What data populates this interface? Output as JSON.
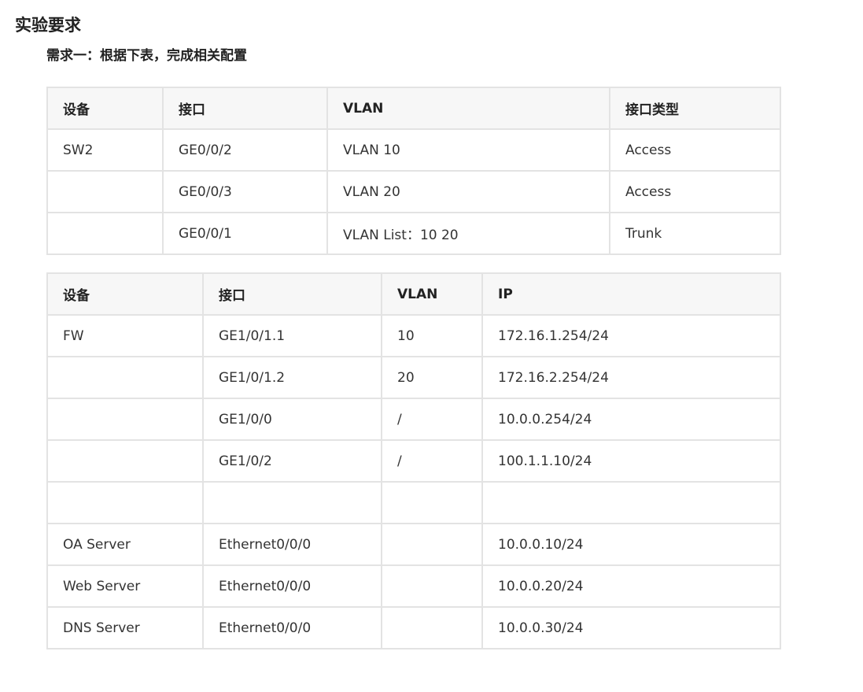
{
  "page": {
    "title": "实验要求",
    "subtitle": "需求一：根据下表，完成相关配置"
  },
  "table1": {
    "headers": [
      "设备",
      "接口",
      "VLAN",
      "接口类型"
    ],
    "rows": [
      [
        "SW2",
        "GE0/0/2",
        "VLAN 10",
        "Access"
      ],
      [
        "",
        "GE0/0/3",
        "VLAN 20",
        "Access"
      ],
      [
        "",
        "GE0/0/1",
        "VLAN List：10 20",
        "Trunk"
      ]
    ]
  },
  "table2": {
    "headers": [
      "设备",
      "接口",
      "VLAN",
      "IP"
    ],
    "rows": [
      [
        "FW",
        "GE1/0/1.1",
        "10",
        "172.16.1.254/24"
      ],
      [
        "",
        "GE1/0/1.2",
        "20",
        "172.16.2.254/24"
      ],
      [
        "",
        "GE1/0/0",
        "/",
        "10.0.0.254/24"
      ],
      [
        "",
        "GE1/0/2",
        "/",
        "100.1.1.10/24"
      ],
      [
        "",
        "",
        "",
        ""
      ],
      [
        "OA Server",
        "Ethernet0/0/0",
        "",
        "10.0.0.10/24"
      ],
      [
        "Web Server",
        "Ethernet0/0/0",
        "",
        "10.0.0.20/24"
      ],
      [
        "DNS Server",
        "Ethernet0/0/0",
        "",
        "10.0.0.30/24"
      ]
    ]
  }
}
